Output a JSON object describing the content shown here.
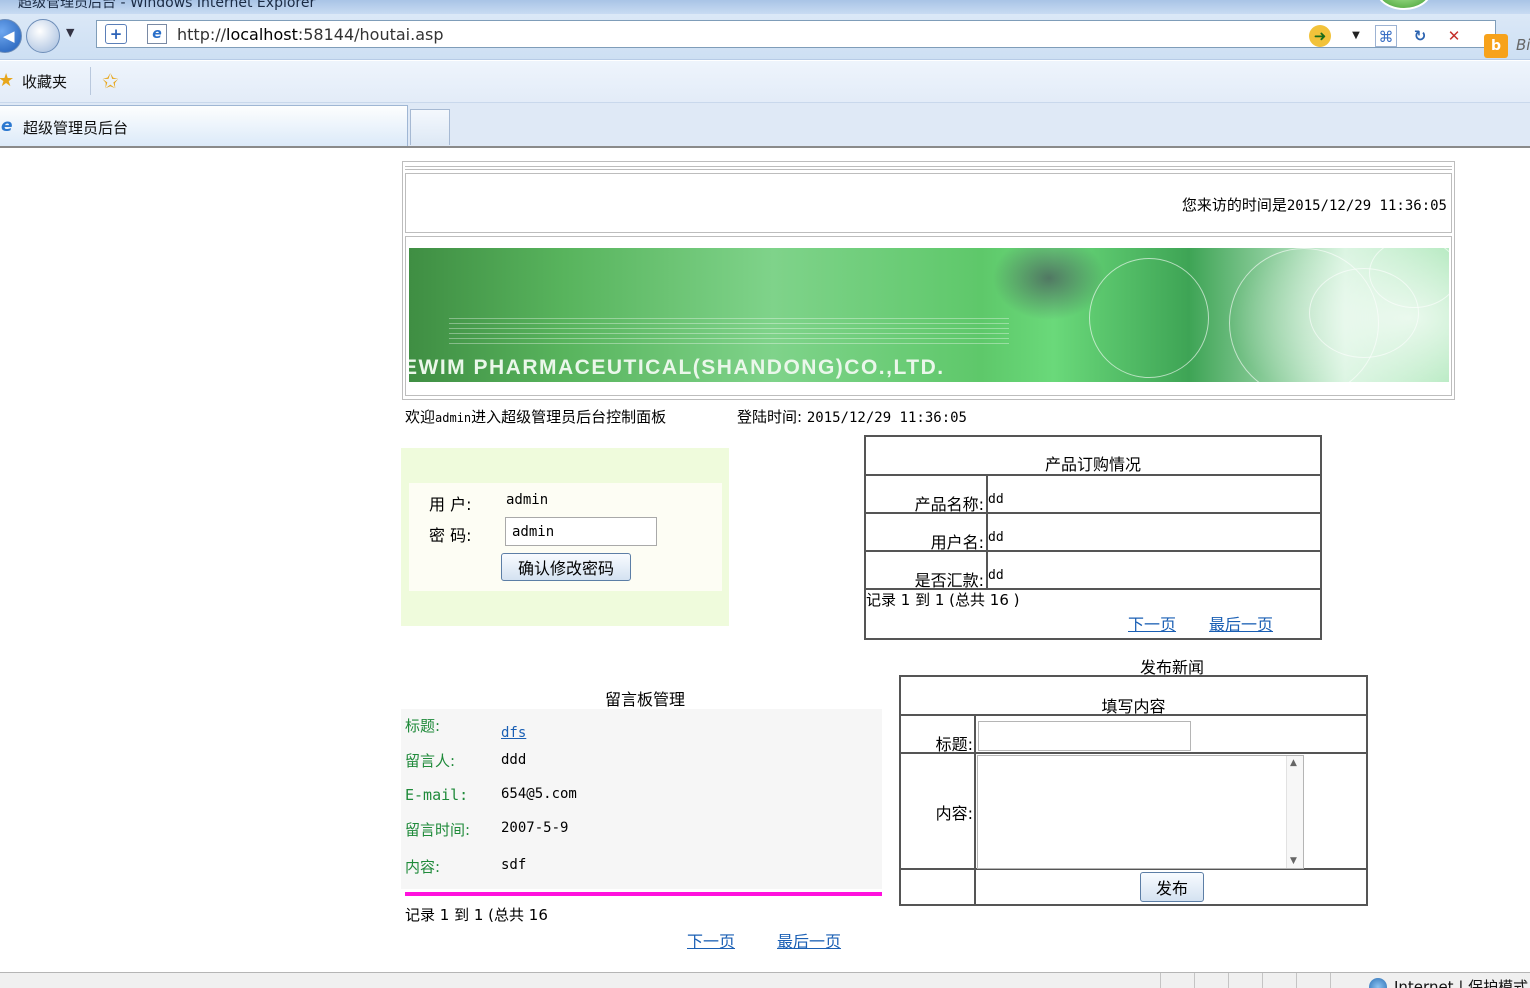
{
  "window": {
    "title": "超级管理员后台 - Windows Internet Explorer"
  },
  "browser": {
    "url_prefix": "http://",
    "url_host": "localhost",
    "url_rest": ":58144/houtai.asp",
    "favorites_label": "收藏夹",
    "tab_label": "超级管理员后台",
    "search_text": "Bi",
    "status_zone": "Internet | 保护模式",
    "icons": {
      "back": "back-arrow-icon",
      "forward": "forward-arrow-icon",
      "page": "ie-page-icon",
      "compat": "compatibility-view-icon",
      "go": "go-icon",
      "rss": "rss-icon",
      "refresh": "refresh-icon",
      "stop": "stop-icon",
      "bing": "bing-icon",
      "favorites": "favorites-star-icon",
      "zone": "globe-icon"
    }
  },
  "header": {
    "visit_prefix": "您来访的时间是",
    "visit_time": "2015/12/29 11:36:05",
    "banner_text": "EWIM PHARMACEUTICAL(SHANDONG)CO.,LTD."
  },
  "welcome": {
    "prefix": "欢迎",
    "user": "admin",
    "suffix": "进入超级管理员后台控制面板",
    "login_label": "登陆时间:",
    "login_time": "2015/12/29 11:36:05"
  },
  "password_form": {
    "user_label": "用 户:",
    "user_value": "admin",
    "password_label": "密 码:",
    "password_value": "admin",
    "submit_label": "确认修改密码"
  },
  "orders": {
    "caption": "产品订购情况",
    "rows": [
      {
        "label": "产品名称:",
        "value": "dd"
      },
      {
        "label": "用户名:",
        "value": "dd"
      },
      {
        "label": "是否汇款:",
        "value": "dd"
      }
    ],
    "records": "记录 1 到 1 (总共 16 )",
    "next": "下一页",
    "last": "最后一页"
  },
  "guestbook": {
    "title": "留言板管理",
    "fields": [
      {
        "label": "标题:",
        "value": "dfs",
        "link": true
      },
      {
        "label": "留言人:",
        "value": "ddd",
        "link": false
      },
      {
        "label": "E-mail:",
        "value": "654@5.com",
        "link": false
      },
      {
        "label": "留言时间:",
        "value": "2007-5-9",
        "link": false
      },
      {
        "label": "内容:",
        "value": "sdf",
        "link": false
      }
    ],
    "records": "记录 1 到 1 (总共 16",
    "next": "下一页",
    "last": "最后一页"
  },
  "news": {
    "title": "发布新闻",
    "caption": "填写内容",
    "title_label": "标题:",
    "title_value": "",
    "content_label": "内容:",
    "content_value": "",
    "submit_label": "发布"
  }
}
